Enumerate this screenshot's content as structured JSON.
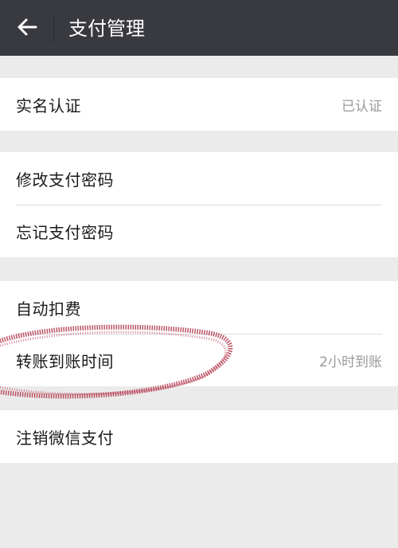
{
  "header": {
    "title": "支付管理",
    "back_icon": "arrow-left-icon"
  },
  "groups": [
    {
      "items": [
        {
          "label": "实名认证",
          "value": "已认证"
        }
      ]
    },
    {
      "items": [
        {
          "label": "修改支付密码"
        },
        {
          "label": "忘记支付密码"
        }
      ]
    },
    {
      "items": [
        {
          "label": "自动扣费"
        },
        {
          "label": "转账到账时间",
          "value": "2小时到账"
        }
      ]
    },
    {
      "items": [
        {
          "label": "注销微信支付"
        }
      ]
    }
  ],
  "colors": {
    "header_bg": "#393a3f",
    "page_bg": "#ebebeb",
    "annotation_stroke": "#b0364a"
  }
}
